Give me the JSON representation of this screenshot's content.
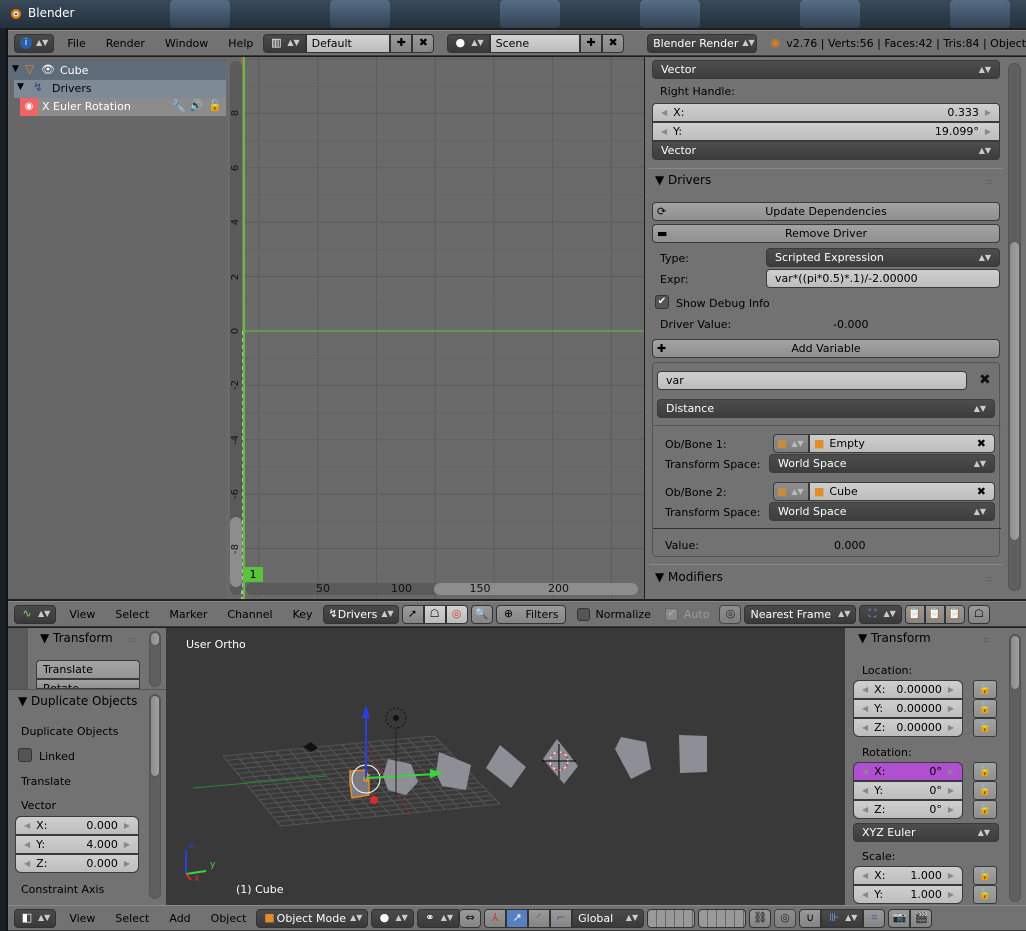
{
  "window": {
    "title": "Blender"
  },
  "top_header": {
    "editor_icon": "info-icon",
    "menus": [
      "File",
      "Render",
      "Window",
      "Help"
    ],
    "screen_layout": "Default",
    "scene": "Scene",
    "render_engine": "Blender Render",
    "stats": "v2.76 | Verts:56 | Faces:42 | Tris:84 | Object"
  },
  "channels": {
    "items": [
      {
        "label": "Cube",
        "icon": "object-icon"
      },
      {
        "label": "Drivers",
        "icon": "drivers-icon"
      },
      {
        "label": "X Euler Rotation",
        "icon": "eye-icon"
      }
    ]
  },
  "graph": {
    "y_ticks": [
      "8",
      "6",
      "4",
      "2",
      "0",
      "-2",
      "-4",
      "-6",
      "-8"
    ],
    "x_ticks": [
      "50",
      "100",
      "150",
      "200"
    ],
    "current_frame": "1"
  },
  "driver_panel": {
    "vector_1": "Vector",
    "right_handle_label": "Right Handle:",
    "handle_x_label": "X:",
    "handle_x": "0.333",
    "handle_y_label": "Y:",
    "handle_y": "19.099°",
    "vector_2": "Vector",
    "drivers_section": "Drivers",
    "update_dependencies": "Update Dependencies",
    "remove_driver": "Remove Driver",
    "type_label": "Type:",
    "type_value": "Scripted Expression",
    "expr_label": "Expr:",
    "expr_value": "var*((pi*0.5)*.1)/-2.00000",
    "show_debug": "Show Debug Info",
    "driver_value_label": "Driver Value:",
    "driver_value": "-0.000",
    "add_variable": "Add Variable",
    "var_name": "var",
    "var_type": "Distance",
    "ob1_label": "Ob/Bone 1:",
    "ob1_value": "Empty",
    "ts1_label": "Transform Space:",
    "ts1_value": "World Space",
    "ob2_label": "Ob/Bone 2:",
    "ob2_value": "Cube",
    "ts2_label": "Transform Space:",
    "ts2_value": "World Space",
    "value_label": "Value:",
    "value": "0.000",
    "modifiers_section": "Modifiers"
  },
  "graph_header": {
    "menus": [
      "View",
      "Select",
      "Marker",
      "Channel",
      "Key"
    ],
    "mode": "Drivers",
    "filters": "Filters",
    "normalize": "Normalize",
    "auto": "Auto",
    "snap": "Nearest Frame"
  },
  "tool_shelf": {
    "transform_section": "Transform",
    "translate": "Translate",
    "rotate": "Rotate",
    "operator_section": "Duplicate Objects",
    "op_title": "Duplicate Objects",
    "linked": "Linked",
    "translate_label": "Translate",
    "vector_label": "Vector",
    "vx_label": "X:",
    "vx": "0.000",
    "vy_label": "Y:",
    "vy": "4.000",
    "vz_label": "Z:",
    "vz": "0.000",
    "constraint_axis": "Constraint Axis"
  },
  "viewport": {
    "view_name": "User Ortho",
    "object_info": "(1) Cube",
    "axis_z": "z",
    "axis_y": "y",
    "axis_x": "x"
  },
  "properties": {
    "section": "Transform",
    "location_label": "Location:",
    "loc": [
      {
        "axis": "X:",
        "value": "0.00000"
      },
      {
        "axis": "Y:",
        "value": "0.00000"
      },
      {
        "axis": "Z:",
        "value": "0.00000"
      }
    ],
    "rotation_label": "Rotation:",
    "rot": [
      {
        "axis": "X:",
        "value": "0°"
      },
      {
        "axis": "Y:",
        "value": "0°"
      },
      {
        "axis": "Z:",
        "value": "0°"
      }
    ],
    "rotation_mode": "XYZ Euler",
    "scale_label": "Scale:",
    "scale": [
      {
        "axis": "X:",
        "value": "1.000"
      },
      {
        "axis": "Y:",
        "value": "1.000"
      }
    ]
  },
  "view3d_header": {
    "menus": [
      "View",
      "Select",
      "Add",
      "Object"
    ],
    "mode": "Object Mode",
    "orientation": "Global"
  },
  "colors": {
    "driver_highlight": "#b04fd0",
    "frame_green": "#5bc23a",
    "channel_red": "#ef6464",
    "accent_orange": "#e38b2c"
  }
}
